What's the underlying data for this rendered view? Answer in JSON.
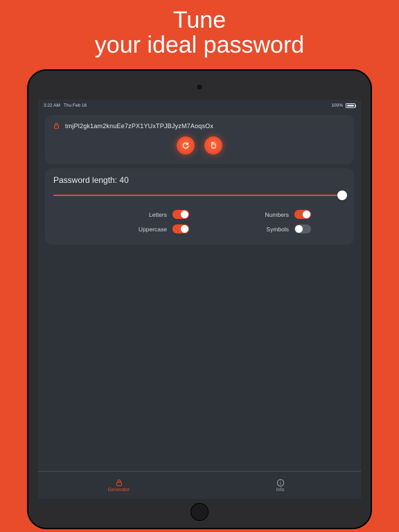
{
  "hero": {
    "line1": "Tune",
    "line2": "your ideal password"
  },
  "status": {
    "time": "3:22 AM",
    "date": "Thu Feb 16",
    "battery": "100%"
  },
  "password": {
    "value": "tmjPl2gk1am2knuEe7zPX1YUxTPJBJyzM7AoqsOx"
  },
  "length": {
    "label_prefix": "Password length: ",
    "value": "40"
  },
  "toggles": {
    "letters": {
      "label": "Letters",
      "on": true
    },
    "numbers": {
      "label": "Numbers",
      "on": true
    },
    "uppercase": {
      "label": "Uppercase",
      "on": true
    },
    "symbols": {
      "label": "Symbols",
      "on": false
    }
  },
  "tabs": {
    "generator": {
      "label": "Generator"
    },
    "info": {
      "label": "Info"
    }
  },
  "colors": {
    "accent": "#e84c2b",
    "bg": "#2e333a",
    "card": "#353a42"
  }
}
